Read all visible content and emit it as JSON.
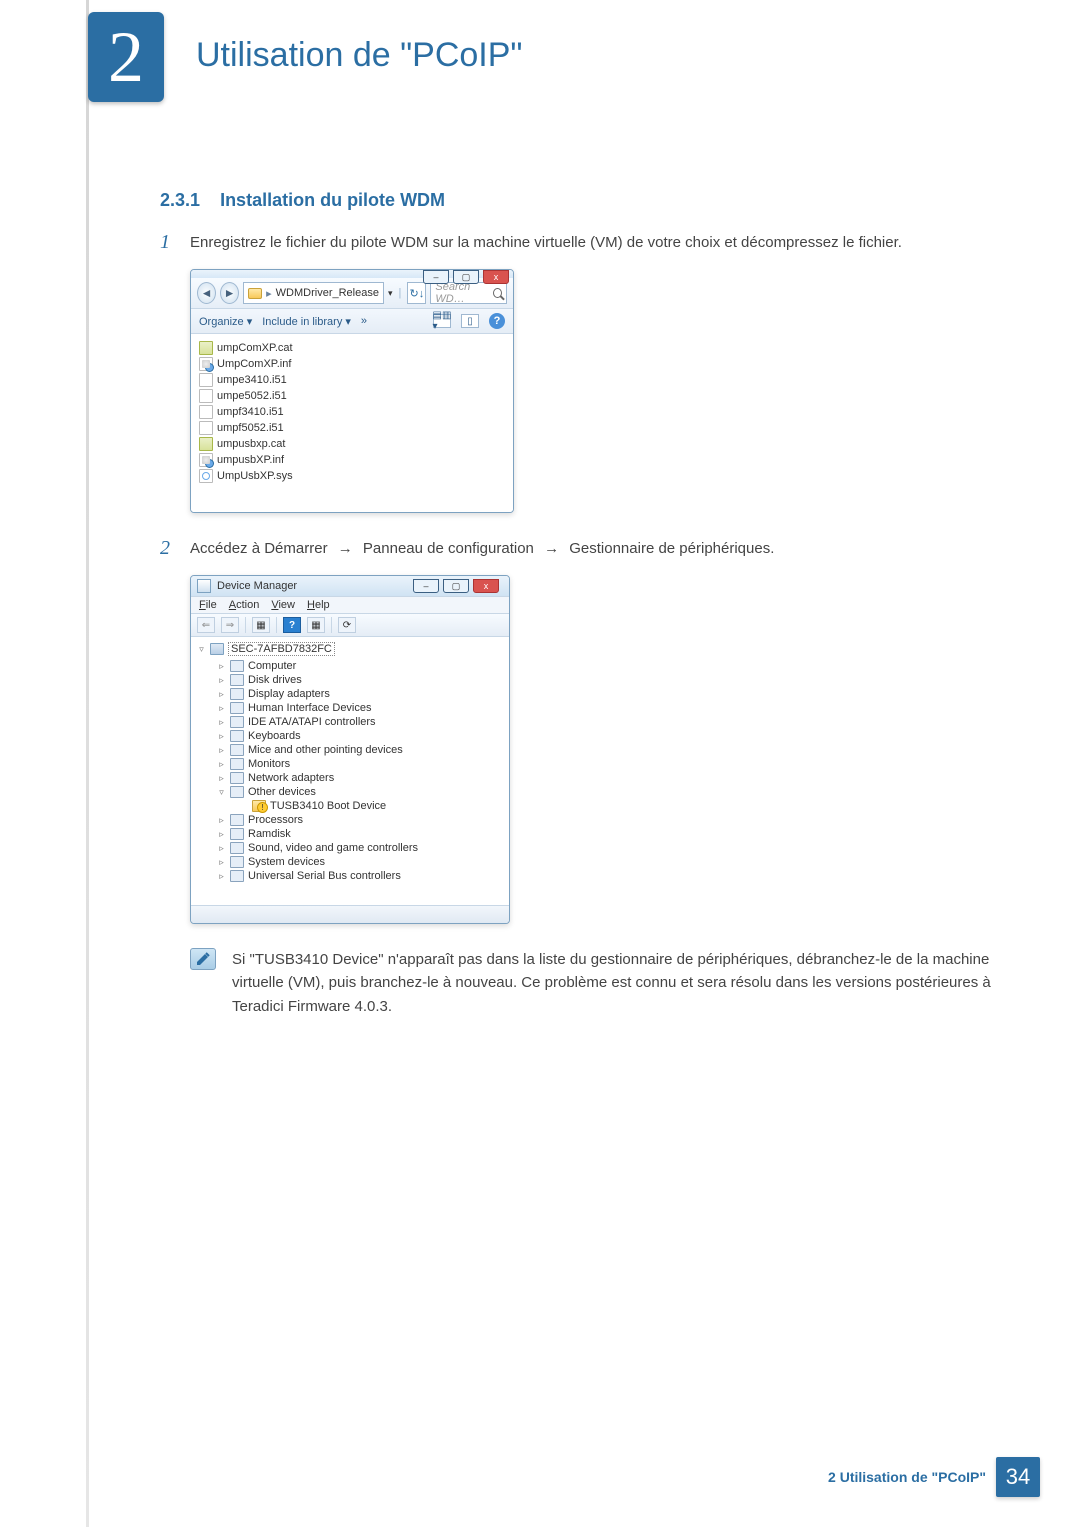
{
  "chapter": {
    "number": "2",
    "title": "Utilisation de \"PCoIP\""
  },
  "section": {
    "number": "2.3.1",
    "title": "Installation du pilote WDM"
  },
  "steps": {
    "s1": {
      "num": "1",
      "text": "Enregistrez le fichier du pilote WDM sur la machine virtuelle (VM) de votre choix et décompressez le fichier."
    },
    "s2": {
      "num": "2",
      "pre": "Accédez à ",
      "a": "Démarrer",
      "b": "Panneau de configuration",
      "c": "Gestionnaire de périphériques",
      "post": "."
    }
  },
  "explorer": {
    "min": "–",
    "max": "▢",
    "close": "x",
    "crumb_sep": "▸",
    "crumb_label": "WDMDriver_Release",
    "dropdown": "▾",
    "refresh": "↻↓",
    "search_placeholder": "Search WD…",
    "toolbar": {
      "organize": "Organize ▾",
      "include": "Include in library ▾",
      "chev": "»",
      "views": "▤▥ ▾",
      "panel": "▯"
    },
    "files": [
      {
        "icon": "cat",
        "name": "umpComXP.cat"
      },
      {
        "icon": "inf",
        "name": "UmpComXP.inf"
      },
      {
        "icon": "plain",
        "name": "umpe3410.i51"
      },
      {
        "icon": "plain",
        "name": "umpe5052.i51"
      },
      {
        "icon": "plain",
        "name": "umpf3410.i51"
      },
      {
        "icon": "plain",
        "name": "umpf5052.i51"
      },
      {
        "icon": "cat",
        "name": "umpusbxp.cat"
      },
      {
        "icon": "inf",
        "name": "umpusbXP.inf"
      },
      {
        "icon": "sys",
        "name": "UmpUsbXP.sys"
      }
    ]
  },
  "dm": {
    "title": "Device Manager",
    "min": "–",
    "max": "▢",
    "close": "x",
    "menu": {
      "file": "File",
      "action": "Action",
      "view": "View",
      "help": "Help"
    },
    "tb": {
      "back": "⇐",
      "fwd": "⇒",
      "q": "?"
    },
    "root": "SEC-7AFBD7832FC",
    "exp_closed": "▹",
    "exp_open": "▿",
    "nodes": [
      {
        "exp": "closed",
        "label": "Computer"
      },
      {
        "exp": "closed",
        "label": "Disk drives"
      },
      {
        "exp": "closed",
        "label": "Display adapters"
      },
      {
        "exp": "closed",
        "label": "Human Interface Devices"
      },
      {
        "exp": "closed",
        "label": "IDE ATA/ATAPI controllers"
      },
      {
        "exp": "closed",
        "label": "Keyboards"
      },
      {
        "exp": "closed",
        "label": "Mice and other pointing devices"
      },
      {
        "exp": "closed",
        "label": "Monitors"
      },
      {
        "exp": "closed",
        "label": "Network adapters"
      },
      {
        "exp": "open",
        "label": "Other devices"
      },
      {
        "exp": "sub",
        "label": "TUSB3410 Boot Device"
      },
      {
        "exp": "closed",
        "label": "Processors"
      },
      {
        "exp": "closed",
        "label": "Ramdisk"
      },
      {
        "exp": "closed",
        "label": "Sound, video and game controllers"
      },
      {
        "exp": "closed",
        "label": "System devices"
      },
      {
        "exp": "closed",
        "label": "Universal Serial Bus controllers"
      }
    ]
  },
  "note": "Si \"TUSB3410 Device\" n'apparaît pas dans la liste du gestionnaire de périphériques, débranchez-le de la machine virtuelle (VM), puis branchez-le à nouveau. Ce problème est connu et sera résolu dans les versions postérieures à Teradici Firmware 4.0.3.",
  "footer": {
    "label": "2 Utilisation de \"PCoIP\"",
    "page": "34"
  }
}
